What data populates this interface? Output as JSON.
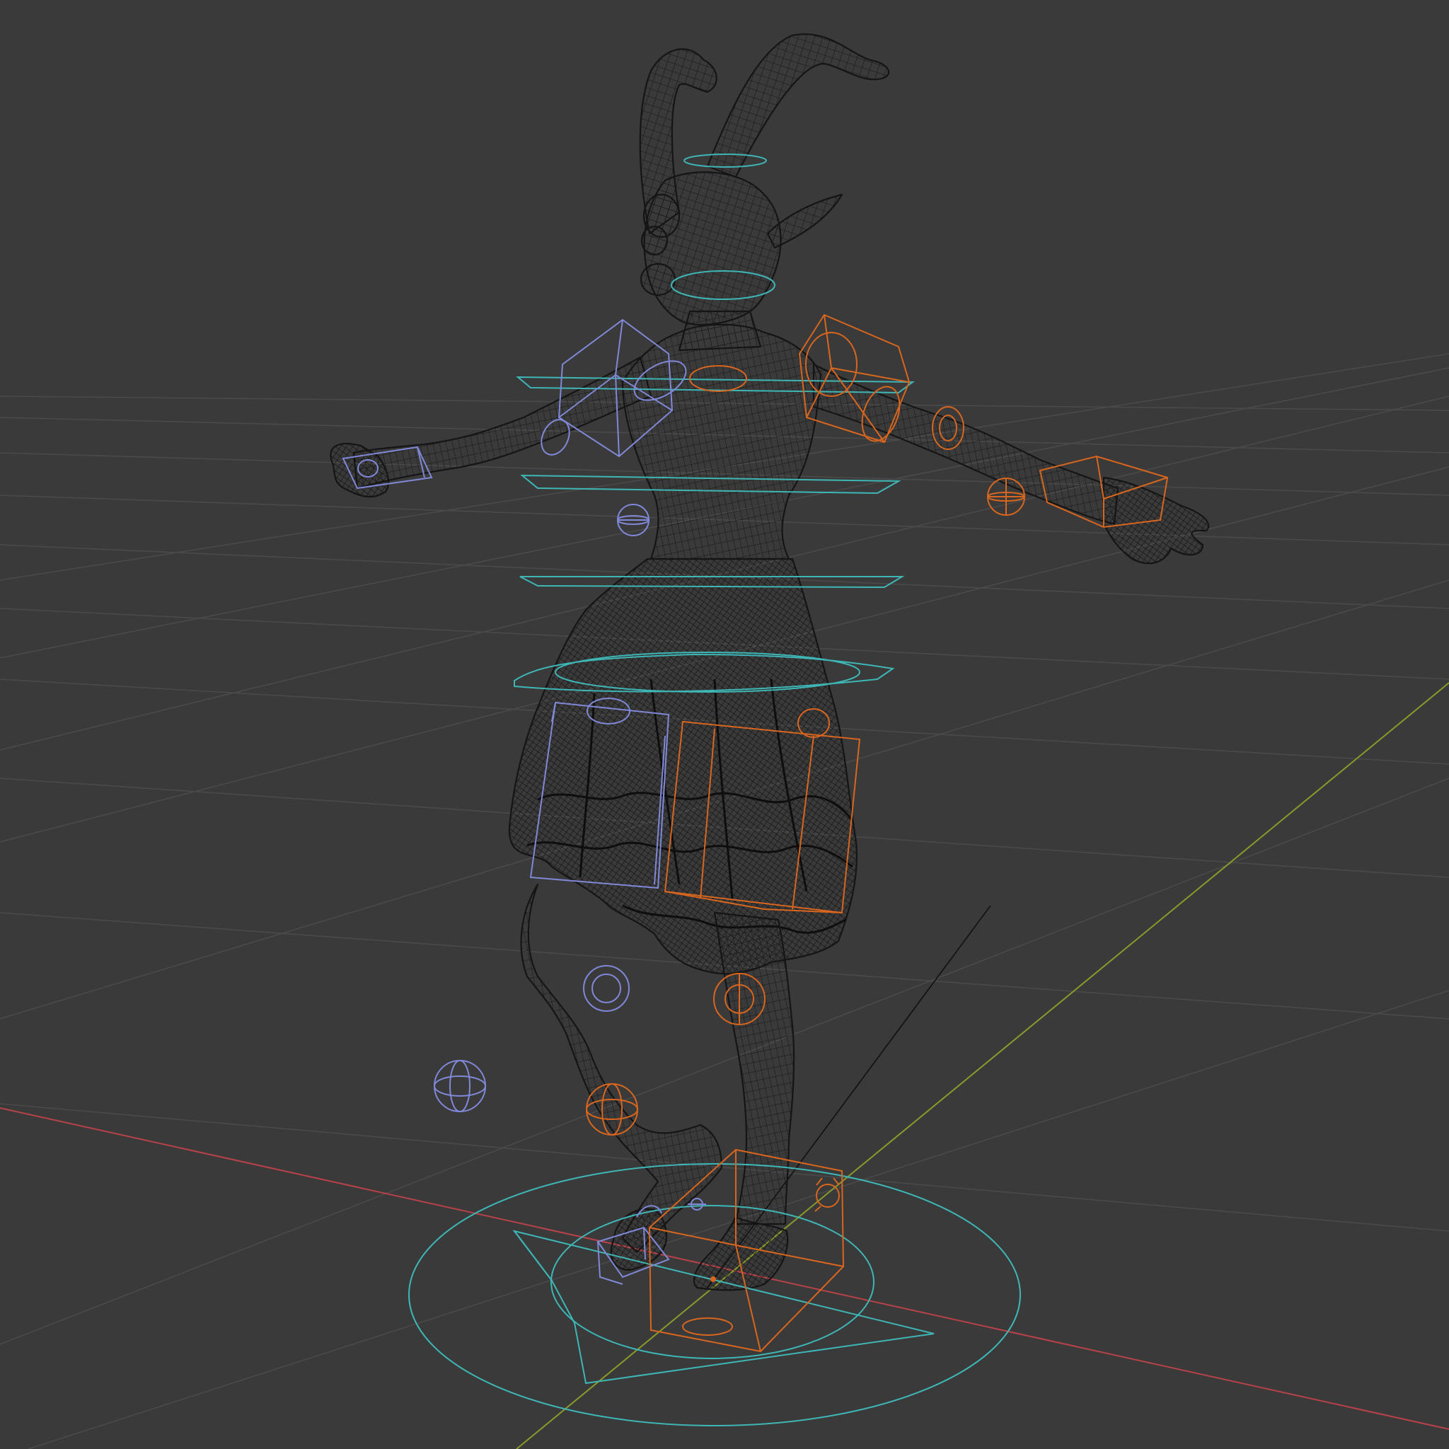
{
  "viewport": {
    "mode": "wireframe",
    "background_color": "#3a3a3a",
    "grid_color": "#4a4a4a",
    "mesh_color": "#151515",
    "axis_x_color": "#b8424a",
    "axis_y_color": "#8a9a2a"
  },
  "rig": {
    "root_control_color": "#3fb6b6",
    "spine_control_color": "#3fb6b6",
    "left_side_color": "#8088d8",
    "right_side_color": "#d8661e",
    "selected_color": "#e08a2e"
  },
  "icons": {
    "ik_pole": "sphere-gizmo-icon",
    "fk_control": "box-gizmo-icon",
    "spine_control": "ring-gizmo-icon"
  }
}
